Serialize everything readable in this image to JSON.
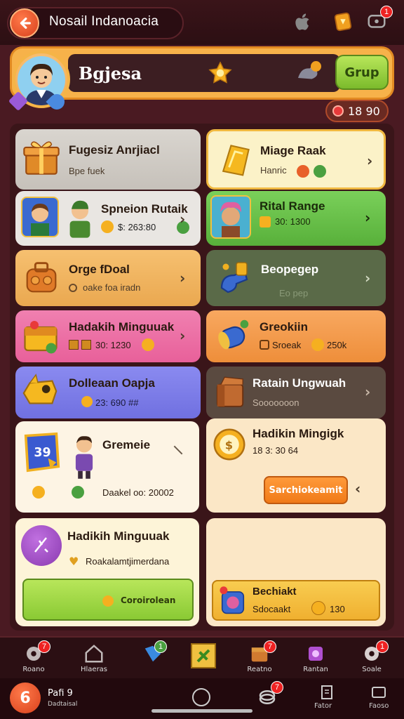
{
  "header": {
    "title": "Nosail Indanoacia",
    "notif_count": "1"
  },
  "profile": {
    "name": "Bgjesa",
    "group_label": "Grup",
    "currency": "18 90"
  },
  "cards": [
    {
      "title": "Fugesiz Anrjiacl",
      "sub": "Bpe fuek"
    },
    {
      "title": "Miage Raak",
      "sub": "Hanric"
    },
    {
      "title": "Spneion Rutaik",
      "sub": "$: 263:80"
    },
    {
      "title": "Rital Range",
      "sub": "30: 1300"
    },
    {
      "title": "Orge fDoal",
      "sub": "oake foa iradn"
    },
    {
      "title": "Beopegep",
      "sub": "Eo pep"
    },
    {
      "title": "Hadakih Minguuak",
      "sub": "30: 1230"
    },
    {
      "title": "Greokiin",
      "sub": "Sroeak",
      "value": "250k"
    },
    {
      "title": "Dolleaan Oapja",
      "sub": "23: 690 ##"
    },
    {
      "title": "Ratain Ungwuah",
      "sub": "Sooooooon"
    },
    {
      "title": "Gremeie",
      "sub": "Daakel oo: 20002"
    },
    {
      "title": "Hadikin Mingigk",
      "sub": "18 3: 30 64",
      "button": "Sarchiokeamit"
    },
    {
      "title": "Hadikih Minguuak",
      "sub": "Roakalamtjimerdana",
      "button": "Coroirolean"
    },
    {
      "title": "Bechiakt",
      "sub": "Sdocaakt",
      "value": "130"
    }
  ],
  "nav_top": [
    {
      "label": "Roano",
      "badge": "7"
    },
    {
      "label": "Hlaeras"
    },
    {
      "label": "",
      "badge": "1"
    },
    {
      "label": ""
    },
    {
      "label": "Reatno",
      "badge": "7"
    },
    {
      "label": "Rantan"
    },
    {
      "label": "Soale",
      "badge": "1"
    }
  ],
  "nav_bottom": {
    "badge_num": "6",
    "title": "Pafi 9",
    "sub": "Dadtaisal",
    "badge": "7",
    "item_a": "Fator",
    "item_b": "Faoso"
  },
  "colors": {
    "accent": "#f7b24a",
    "background": "#4a1a22"
  }
}
